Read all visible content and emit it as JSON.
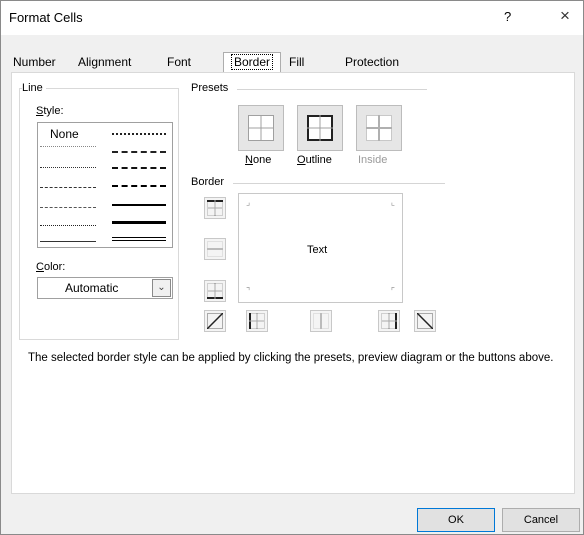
{
  "window": {
    "title": "Format Cells",
    "help_label": "?",
    "close_label": "×"
  },
  "tabs": [
    {
      "label": "Number"
    },
    {
      "label": "Alignment"
    },
    {
      "label": "Font"
    },
    {
      "label": "Border",
      "active": true
    },
    {
      "label": "Fill"
    },
    {
      "label": "Protection"
    }
  ],
  "line_group": {
    "label": "Line",
    "style_label": "Style:",
    "style_none": "None",
    "color_label": "Color:",
    "color_value": "Automatic"
  },
  "presets": {
    "label": "Presets",
    "items": [
      {
        "label": "None",
        "disabled": false
      },
      {
        "label": "Outline",
        "disabled": false
      },
      {
        "label": "Inside",
        "disabled": true
      }
    ]
  },
  "border": {
    "label": "Border",
    "preview_text": "Text"
  },
  "description": "The selected border style can be applied by clicking the presets, preview diagram or the buttons above.",
  "buttons": {
    "ok": "OK",
    "cancel": "Cancel"
  }
}
